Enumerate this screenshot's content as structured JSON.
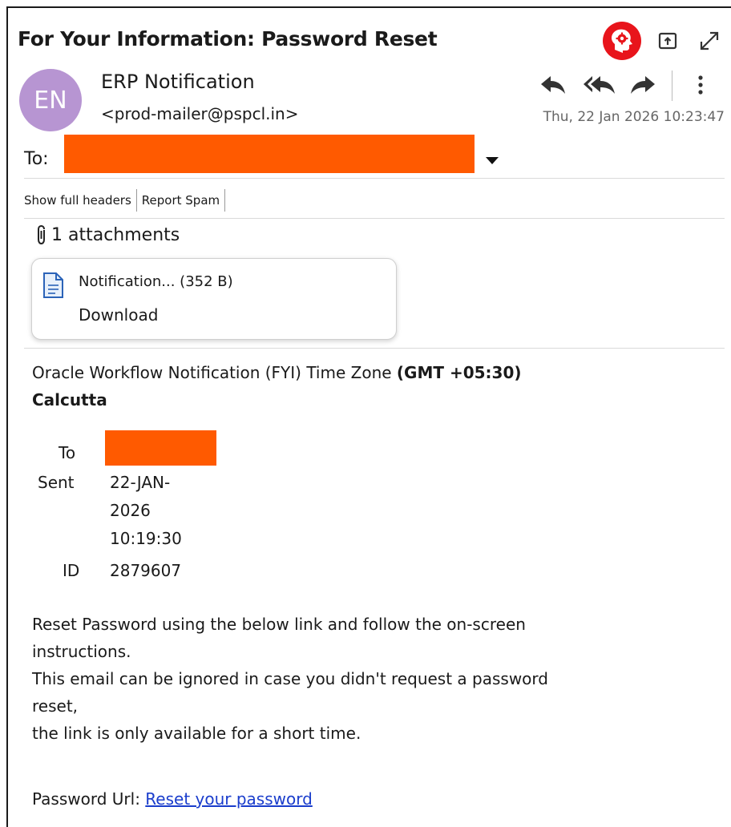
{
  "email": {
    "subject": "For Your Information: Password Reset",
    "avatar_initials": "EN",
    "sender_name": "ERP Notification",
    "sender_email": "<prod-mailer@pspcl.in>",
    "date": "Thu, 22 Jan 2026 10:23:47",
    "to_label": "To:",
    "header_links": [
      "Show full headers",
      "Report Spam"
    ]
  },
  "attachments": {
    "heading": "1 attachments",
    "items": [
      {
        "name": "Notification... (352 B)",
        "action": "Download"
      }
    ]
  },
  "body": {
    "intro": "Oracle Workflow Notification (FYI) Time Zone",
    "timezone_bold_1": "(GMT +05:30)",
    "timezone_bold_2": "Calcutta",
    "fields": {
      "to_label": "To",
      "sent_label": "Sent",
      "sent_line1": "22-JAN-",
      "sent_line2": "2026",
      "sent_line3": "10:19:30",
      "id_label": "ID",
      "id_value": "2879607"
    },
    "para1_line1": "Reset Password using the below link and follow the on-screen",
    "para1_line2": "instructions.",
    "para2_line1": "This email can be ignored in case you didn't request a password",
    "para2_line2": "reset,",
    "para3": "the link is only available for a short time.",
    "url_label": "Password Url:",
    "url_link": "Reset your password"
  },
  "colors": {
    "redaction": "#ff5a00",
    "avatar_bg": "#b795d2",
    "badge_red": "#e8141b",
    "link_blue": "#1a3dcc"
  },
  "icons": [
    "settings-badge-icon",
    "popout-icon",
    "expand-icon",
    "reply-icon",
    "reply-all-icon",
    "forward-icon",
    "more-icon",
    "chevron-down-icon",
    "paperclip-icon",
    "file-icon"
  ]
}
